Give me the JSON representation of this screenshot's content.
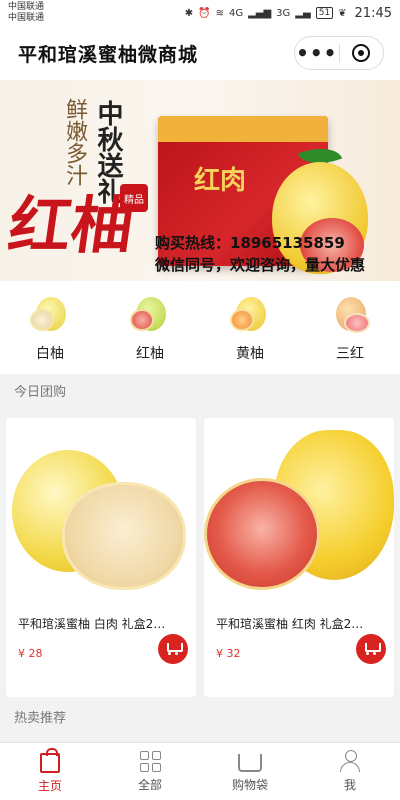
{
  "statusbar": {
    "carrier1": "中国联通",
    "carrier2": "中国联通",
    "net1": "4G",
    "net2": "3G",
    "battery": "51",
    "time": "21:45"
  },
  "header": {
    "title": "平和琯溪蜜柚微商城"
  },
  "banner": {
    "slogan_vertical": "鲜嫩多汁",
    "headline_vertical": "中秋送礼",
    "big_text": "红柚",
    "seal_text": "精品",
    "box_text": "红肉",
    "hotline": "购买热线：18965135859",
    "wechat_line": "微信同号，欢迎咨询，量大优惠"
  },
  "categories": [
    {
      "label": "白柚"
    },
    {
      "label": "红柚"
    },
    {
      "label": "黄柚"
    },
    {
      "label": "三红"
    }
  ],
  "section_group": {
    "title": "今日团购"
  },
  "products": [
    {
      "name": "平和琯溪蜜柚 白肉 礼盒2…",
      "price": "¥ 28"
    },
    {
      "name": "平和琯溪蜜柚 红肉 礼盒2…",
      "price": "¥ 32"
    }
  ],
  "section_hot": {
    "title": "热卖推荐"
  },
  "tabbar": [
    {
      "label": "主页",
      "icon": "home-bag-icon",
      "active": true
    },
    {
      "label": "全部",
      "icon": "grid-icon",
      "active": false
    },
    {
      "label": "购物袋",
      "icon": "cart-icon",
      "active": false
    },
    {
      "label": "我",
      "icon": "user-icon",
      "active": false
    }
  ],
  "colors": {
    "accent": "#d11f1f",
    "price": "#e0322a"
  }
}
